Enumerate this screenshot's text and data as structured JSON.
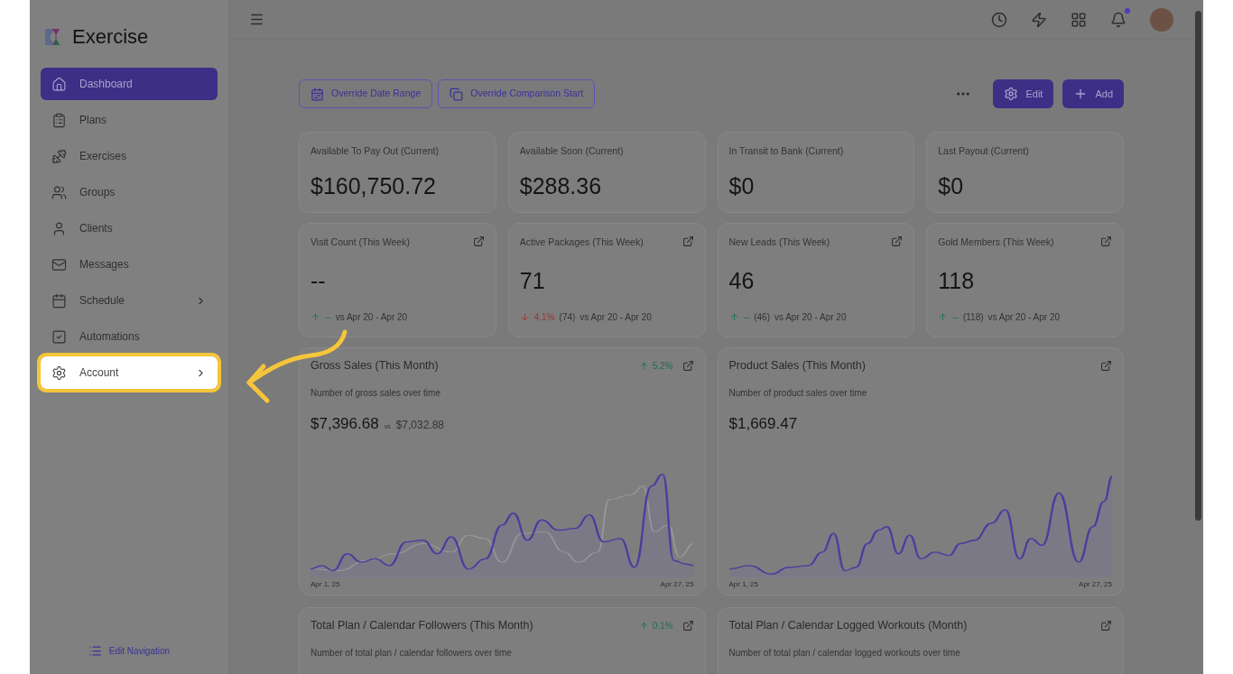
{
  "app": {
    "name": "Exercise"
  },
  "sidebar": {
    "items": [
      {
        "label": "Dashboard",
        "selected": true,
        "highlighted": false,
        "expandable": false
      },
      {
        "label": "Plans",
        "selected": false,
        "highlighted": false,
        "expandable": false
      },
      {
        "label": "Exercises",
        "selected": false,
        "highlighted": false,
        "expandable": false
      },
      {
        "label": "Groups",
        "selected": false,
        "highlighted": false,
        "expandable": false
      },
      {
        "label": "Clients",
        "selected": false,
        "highlighted": false,
        "expandable": false
      },
      {
        "label": "Messages",
        "selected": false,
        "highlighted": false,
        "expandable": false
      },
      {
        "label": "Schedule",
        "selected": false,
        "highlighted": false,
        "expandable": true
      },
      {
        "label": "Automations",
        "selected": false,
        "highlighted": false,
        "expandable": false
      },
      {
        "label": "Account",
        "selected": false,
        "highlighted": true,
        "expandable": true
      }
    ],
    "footer": "Edit Navigation"
  },
  "header": {
    "notification_dot": true
  },
  "toolbar": {
    "filters": [
      "Override Date Range",
      "Override Comparison Start"
    ],
    "buttons": [
      "Edit",
      "Add"
    ]
  },
  "balances": [
    {
      "label": "Available To Pay Out (Current)",
      "value": "$160,750.72"
    },
    {
      "label": "Available Soon (Current)",
      "value": "$288.36"
    },
    {
      "label": "In Transit to Bank (Current)",
      "value": "$0"
    },
    {
      "label": "Last Payout (Current)",
      "value": "$0"
    }
  ],
  "weekly": [
    {
      "label": "Visit Count (This Week)",
      "value": "--",
      "up": true,
      "change": "--",
      "compare": "vs Apr 20 - Apr 20"
    },
    {
      "label": "Active Packages (This Week)",
      "value": "71",
      "up": false,
      "change": "4.1%",
      "previous": "(74)",
      "compare": "vs Apr 20 - Apr 20"
    },
    {
      "label": "New Leads (This Week)",
      "value": "46",
      "up": true,
      "change": "--",
      "previous": "(46)",
      "compare": "vs Apr 20 - Apr 20"
    },
    {
      "label": "Gold Members (This Week)",
      "value": "118",
      "up": true,
      "change": "--",
      "previous": "(118)",
      "compare": "vs Apr 20 - Apr 20"
    }
  ],
  "charts": [
    {
      "title": "Gross Sales (This Month)",
      "change": "5.2%",
      "subtitle": "Number of gross sales over time",
      "value": "$7,396.68",
      "vs": "vs",
      "compare": "$7,032.88",
      "x_start": "Apr 1, 25",
      "x_end": "Apr 27, 25"
    },
    {
      "title": "Product Sales (This Month)",
      "subtitle": "Number of product sales over time",
      "value": "$1,669.47",
      "x_start": "Apr 1, 25",
      "x_end": "Apr 27, 25"
    },
    {
      "title": "Total Plan / Calendar Followers (This Month)",
      "change": "0.1%",
      "subtitle": "Number of total plan / calendar followers over time"
    },
    {
      "title": "Total Plan / Calendar Logged Workouts (Month)",
      "subtitle": "Number of total plan / calendar logged workouts over time"
    }
  ]
}
